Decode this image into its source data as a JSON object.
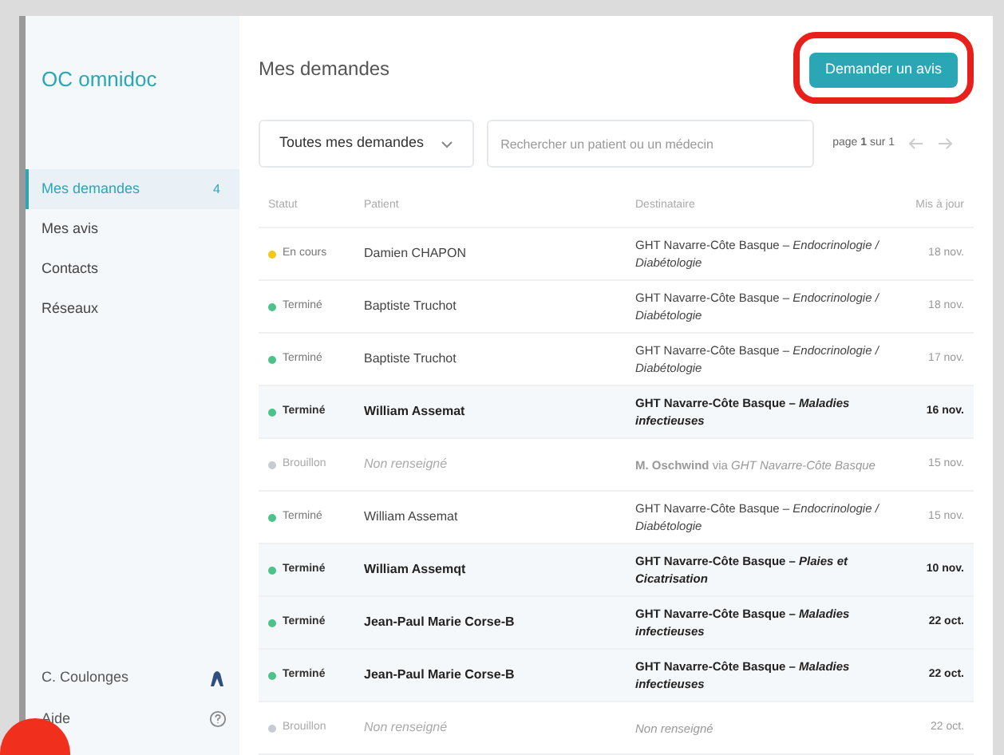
{
  "sidebar": {
    "logo": "OC omnidoc",
    "items": [
      {
        "label": "Mes demandes",
        "badge": "4",
        "selected": true
      },
      {
        "label": "Mes avis",
        "selected": false
      },
      {
        "label": "Contacts",
        "selected": false
      },
      {
        "label": "Réseaux",
        "selected": false
      }
    ],
    "user": "C. Coulonges",
    "help": "Aide"
  },
  "header": {
    "title": "Mes demandes",
    "button": "Demander un avis",
    "button_highlighted": true
  },
  "filters": {
    "dropdown": "Toutes mes demandes",
    "search_placeholder": "Rechercher un patient ou un médecin",
    "pagination": "page **1** sur 1"
  },
  "table": {
    "columns": [
      "Statut",
      "Patient",
      "Destinataire",
      "Mis à jour"
    ],
    "rows": [
      {
        "status": "En cours",
        "kind": "en_cours",
        "patient": "Damien CHAPON",
        "recipient": "GHT Navarre-Côte Basque – *Endocrinologie / Diabétologie*",
        "date": "18 nov.",
        "unread": false
      },
      {
        "status": "Terminé",
        "kind": "termine",
        "patient": "Baptiste Truchot",
        "recipient": "GHT Navarre-Côte Basque – *Endocrinologie / Diabétologie*",
        "date": "18 nov.",
        "unread": false
      },
      {
        "status": "Terminé",
        "kind": "termine",
        "patient": "Baptiste Truchot",
        "recipient": "GHT Navarre-Côte Basque – *Endocrinologie / Diabétologie*",
        "date": "17 nov.",
        "unread": false
      },
      {
        "status": "Terminé",
        "kind": "termine",
        "patient": "William Assemat",
        "recipient": "GHT Navarre-Côte Basque – *Maladies infectieuses*",
        "date": "16 nov.",
        "unread": true
      },
      {
        "status": "Brouillon",
        "kind": "brouillon",
        "patient": "Non renseigné",
        "recipient": "**M. Oschwind** via *GHT Navarre-Côte Basque*",
        "date": "15 nov.",
        "unread": false
      },
      {
        "status": "Terminé",
        "kind": "termine",
        "patient": "William Assemat",
        "recipient": "GHT Navarre-Côte Basque – *Endocrinologie / Diabétologie*",
        "date": "15 nov.",
        "unread": false
      },
      {
        "status": "Terminé",
        "kind": "termine",
        "patient": "William Assemqt",
        "recipient": "GHT Navarre-Côte Basque – *Plaies et Cicatrisation*",
        "date": "10 nov.",
        "unread": true
      },
      {
        "status": "Terminé",
        "kind": "termine",
        "patient": "Jean-Paul Marie Corse-B",
        "recipient": "GHT Navarre-Côte Basque – *Maladies infectieuses*",
        "date": "22 oct.",
        "unread": true
      },
      {
        "status": "Terminé",
        "kind": "termine",
        "patient": "Jean-Paul Marie Corse-B",
        "recipient": "GHT Navarre-Côte Basque – *Maladies infectieuses*",
        "date": "22 oct.",
        "unread": true
      },
      {
        "status": "Brouillon",
        "kind": "brouillon",
        "patient": "Non renseigné",
        "recipient": "*Non renseigné*",
        "date": "22 oct.",
        "unread": false
      }
    ]
  }
}
